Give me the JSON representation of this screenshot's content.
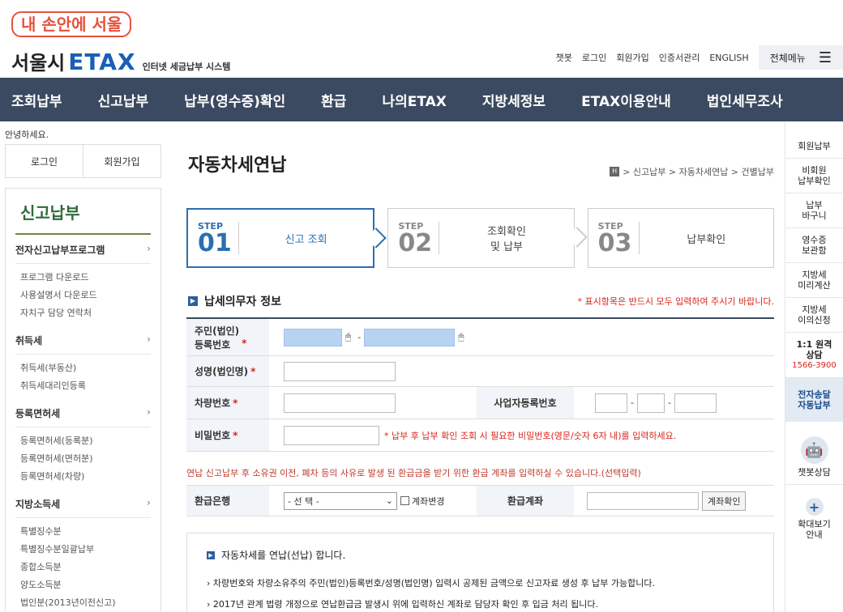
{
  "header": {
    "slogan": "내 손안에 서울",
    "brand_ko": "서울시",
    "brand_etax": "ETAX",
    "brand_sub": "인터넷 세금납부 시스템",
    "util_links": [
      "챗봇",
      "로그인",
      "회원가입",
      "인증서관리",
      "ENGLISH"
    ],
    "all_menu": "전체메뉴"
  },
  "nav": [
    "조회납부",
    "신고납부",
    "납부(영수증)확인",
    "환급",
    "나의ETAX",
    "지방세정보",
    "ETAX이용안내",
    "법인세무조사"
  ],
  "left": {
    "hello": "안녕하세요.",
    "login": "로그인",
    "join": "회원가입",
    "section_title": "신고납부",
    "cat1": "전자신고납부프로그램",
    "cat1_items": [
      "프로그램 다운로드",
      "사용설명서 다운로드",
      "자치구 담당 연락처"
    ],
    "cat2": "취득세",
    "cat2_items": [
      "취득세(부동산)",
      "취득세대리인등록"
    ],
    "cat3": "등록면허세",
    "cat3_items": [
      "등록면허세(등록분)",
      "등록면허세(면허분)",
      "등록면허세(차량)"
    ],
    "cat4": "지방소득세",
    "cat4_items": [
      "특별징수분",
      "특별징수분일괄납부",
      "종합소득분",
      "양도소득분",
      "법인분(2013년이전신고)"
    ]
  },
  "main": {
    "title": "자동차세연납",
    "breadcrumb": "> 신고납부 > 자동차세연납 > 건별납부",
    "steps": [
      {
        "step": "STEP",
        "num": "01",
        "label": "신고 조회"
      },
      {
        "step": "STEP",
        "num": "02",
        "label": "조회확인\n및 납부"
      },
      {
        "step": "STEP",
        "num": "03",
        "label": "납부확인"
      }
    ],
    "section": "납세의무자 정보",
    "required_note": "* 표시항목은 반드시 모두 입력하여 주시기 바랍니다.",
    "f_id": "주민(법인)\n등록번호",
    "f_name": "성명(법인명)",
    "f_car": "차량번호",
    "f_biz": "사업자등록번호",
    "f_pw": "비밀번호",
    "f_pw_note": "* 납부 후 납부 확인 조회 시 필요한 비밀번호(영문/숫자 6자 내)를 입력하세요.",
    "refund_note": "연납 신고납부 후 소유권 이전, 폐차 등의 사유로 발생 된 환급금을 받기 위한 환급 계좌를 입력하실 수 있습니다.(선택입력)",
    "f_bank": "환급은행",
    "bank_select": "- 선 택 -",
    "acct_change": "계좌변경",
    "f_acct": "환급계좌",
    "acct_btn": "계좌확인",
    "info_head": "자동차세를 연납(선납) 합니다.",
    "info_1": "› 차량번호와 차량소유주의 주민(법인)등록번호/성명(법인명) 입력시 공제된 금액으로 신고자료 생성 후 납부 가능합니다.",
    "info_2": "› 2017년 관계 법령 개정으로 연납환급금 발생시 위에 입력하신 계좌로 담당자 확인 후 입금 처리 됩니다."
  },
  "right": {
    "items": [
      "회원납부",
      "비회원\n납부확인",
      "납부\n바구니",
      "영수증\n보관함",
      "지방세\n미리계산",
      "지방세\n이의신청",
      "1:1 원격\n상담"
    ],
    "phone": "1566-3900",
    "highlight": "전자송달\n자동납부",
    "chatbot": "챗봇상담",
    "zoom": "확대보기\n안내"
  }
}
